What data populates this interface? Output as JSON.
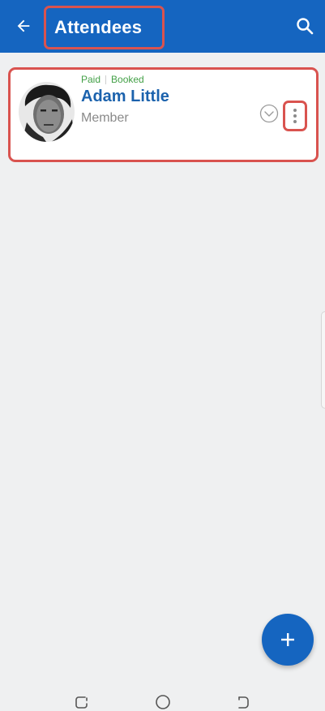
{
  "header": {
    "title": "Attendees",
    "back_icon": "arrow-left-icon",
    "search_icon": "search-icon"
  },
  "attendees": [
    {
      "status_paid": "Paid",
      "status_booked": "Booked",
      "name": "Adam Little",
      "role": "Member",
      "avatar_icon": "avatar-photo",
      "expand_icon": "chevron-down-circle-icon",
      "more_icon": "more-vert-icon"
    }
  ],
  "fab": {
    "icon": "plus-icon"
  },
  "navbar": {
    "recents_icon": "recents-icon",
    "home_icon": "home-circle-icon",
    "back_icon": "nav-back-icon"
  },
  "colors": {
    "primary": "#1565c0",
    "highlight": "#d9534f",
    "status_green": "#43a047",
    "name_blue": "#1b62ad",
    "background": "#eff0f1"
  }
}
